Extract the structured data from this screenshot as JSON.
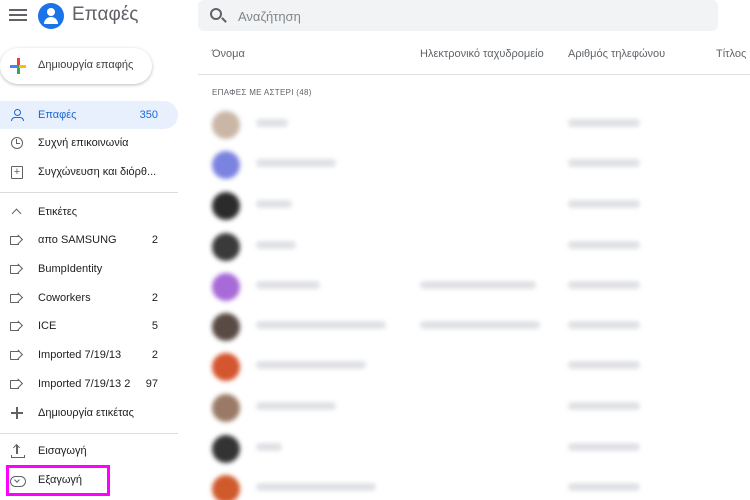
{
  "app": {
    "title": "Επαφές"
  },
  "search": {
    "placeholder": "Αναζήτηση"
  },
  "create_button": {
    "label": "Δημιουργία επαφής"
  },
  "sidebar": {
    "main_items": [
      {
        "label": "Επαφές",
        "count": "350",
        "icon": "person-icon",
        "active": true
      },
      {
        "label": "Συχνή επικοινωνία",
        "count": "",
        "icon": "history-icon",
        "active": false
      },
      {
        "label": "Συγχώνευση και διόρθ...",
        "count": "",
        "icon": "merge-icon",
        "active": false
      }
    ],
    "labels_header": "Ετικέτες",
    "labels": [
      {
        "label": "απο SAMSUNG",
        "count": "2"
      },
      {
        "label": "BumpIdentity",
        "count": ""
      },
      {
        "label": "Coworkers",
        "count": "2"
      },
      {
        "label": "ICE",
        "count": "5"
      },
      {
        "label": "Imported 7/19/13",
        "count": "2"
      },
      {
        "label": "Imported 7/19/13 2",
        "count": "97"
      }
    ],
    "create_label": "Δημιουργία ετικέτας",
    "import_label": "Εισαγωγή",
    "export_label": "Εξαγωγή"
  },
  "table": {
    "columns": [
      "Όνομα",
      "Ηλεκτρονικό ταχυδρομείο",
      "Αριθμός τηλεφώνου",
      "Τίτλος"
    ],
    "section_label": "ΕΠΑΦΕΣ ΜΕ ΑΣΤΕΡΙ (48)"
  },
  "colors": {
    "accent": "#1a73e8",
    "active_bg": "#e8f0fe",
    "highlight": "#ff00ff",
    "avatars": [
      "#c9b6a6",
      "#7b83e0",
      "#2b2b2b",
      "#3a3a3a",
      "#a86ad8",
      "#5a4a44",
      "#d4552e",
      "#9a7a66",
      "#333333",
      "#cf5a2c"
    ]
  }
}
